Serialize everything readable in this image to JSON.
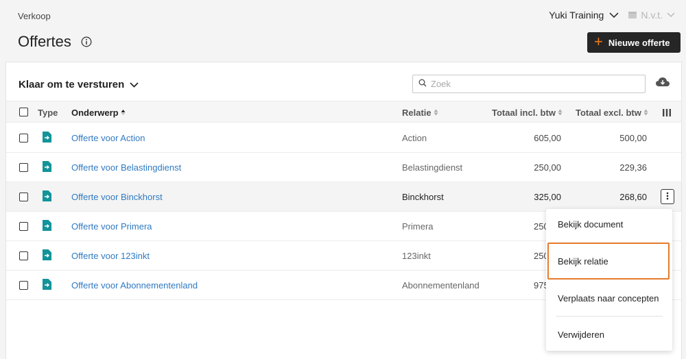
{
  "breadcrumb": "Verkoop",
  "header": {
    "org": "Yuki Training",
    "year": "N.v.t.",
    "title": "Offertes",
    "new_button": "Nieuwe offerte"
  },
  "filter": {
    "label": "Klaar om te versturen"
  },
  "search": {
    "placeholder": "Zoek"
  },
  "table": {
    "columns": {
      "type": "Type",
      "subject": "Onderwerp",
      "relation": "Relatie",
      "total_incl": "Totaal incl. btw",
      "total_excl": "Totaal excl. btw"
    },
    "rows": [
      {
        "subject": "Offerte voor Action",
        "relation": "Action",
        "total_incl": "605,00",
        "total_excl": "500,00"
      },
      {
        "subject": "Offerte voor Belastingdienst",
        "relation": "Belastingdienst",
        "total_incl": "250,00",
        "total_excl": "229,36"
      },
      {
        "subject": "Offerte voor Binckhorst",
        "relation": "Binckhorst",
        "total_incl": "325,00",
        "total_excl": "268,60"
      },
      {
        "subject": "Offerte voor Primera",
        "relation": "Primera",
        "total_incl": "250",
        "total_excl": ""
      },
      {
        "subject": "Offerte voor 123inkt",
        "relation": "123inkt",
        "total_incl": "250",
        "total_excl": ""
      },
      {
        "subject": "Offerte voor Abonnementenland",
        "relation": "Abonnementenland",
        "total_incl": "975",
        "total_excl": ""
      }
    ]
  },
  "context_menu": {
    "items": [
      "Bekijk document",
      "Bekijk relatie",
      "Verplaats naar concepten",
      "Verwijderen"
    ]
  },
  "colors": {
    "accent": "#f07a1a",
    "link": "#2f7ac2",
    "doc_icon": "#13939a",
    "focus": "#e57a2c"
  }
}
